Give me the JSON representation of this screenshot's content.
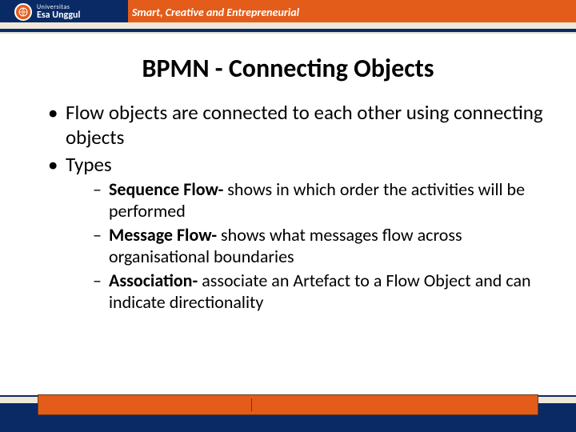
{
  "header": {
    "university_label": "Universitas",
    "university_name": "Esa Unggul",
    "tagline": "Smart, Creative and Entrepreneurial"
  },
  "title": "BPMN - Connecting Objects",
  "bullets": {
    "b1": "Flow objects are connected to each other using connecting objects",
    "b2": "Types",
    "sub": {
      "s1_bold": "Sequence Flow- ",
      "s1_rest": "shows in which order the activities will be performed",
      "s2_bold": "Message Flow- ",
      "s2_rest": "shows what messages flow across organisational boundaries",
      "s3_bold": "Association- ",
      "s3_rest": "associate an Artefact to a Flow Object and can indicate directionality"
    }
  }
}
